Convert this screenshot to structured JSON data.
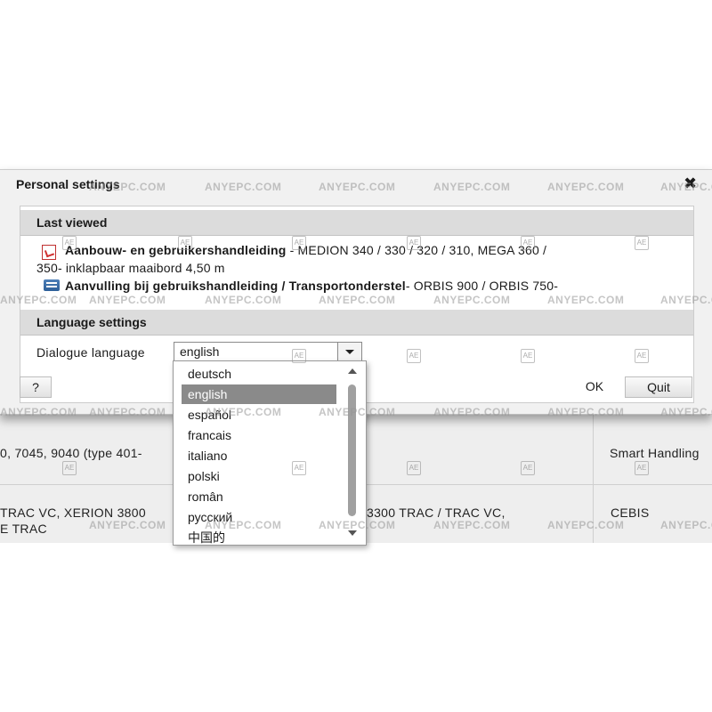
{
  "dialog": {
    "title": "Personal settings",
    "close_glyph": "✖",
    "last_viewed": {
      "heading": "Last viewed",
      "items": [
        {
          "title": "Aanbouw- en gebruikershandleiding",
          "detail": " - MEDION 340 / 330 / 320 / 310, MEGA 360 /",
          "detail_line2": "350- inklapbaar maaibord 4,50 m",
          "icon": "pdf-icon"
        },
        {
          "title": "Aanvulling bij gebruikshandleiding / Transportonderstel",
          "detail": "- ORBIS 900 / ORBIS 750-",
          "icon": "document-icon"
        }
      ]
    },
    "language": {
      "heading": "Language settings",
      "label": "Dialogue language",
      "selected": "english",
      "options": [
        "deutsch",
        "english",
        "español",
        "francais",
        "italiano",
        "polski",
        "român",
        "русский",
        "中国的"
      ]
    },
    "buttons": {
      "help": "?",
      "ok": "OK",
      "quit": "Quit"
    }
  },
  "background_table": {
    "row1": {
      "col1": "0, 7045, 9040 (type 401-",
      "col2": ")",
      "col3": "Smart Handling"
    },
    "row2": {
      "col1_line1": "TRAC VC, XERION 3800",
      "col1_line2": "E TRAC",
      "col2": "3300 TRAC / TRAC VC,",
      "col3": "CEBIS"
    }
  },
  "watermark": {
    "text": "ANYEPC.COM",
    "badge": "AE"
  }
}
